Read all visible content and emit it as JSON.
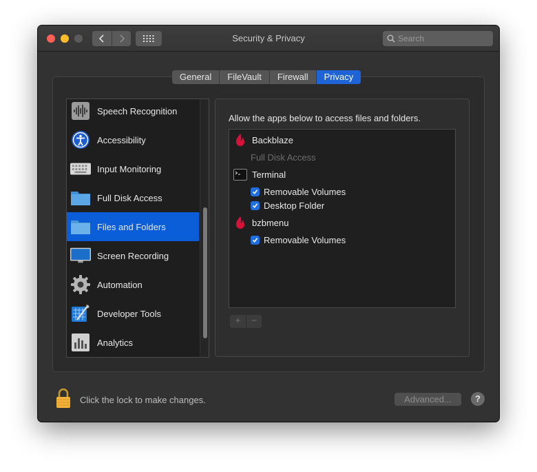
{
  "window": {
    "title": "Security & Privacy"
  },
  "toolbar": {
    "back_icon": "chevron-left-icon",
    "forward_icon": "chevron-right-icon",
    "grid_icon": "grid-icon",
    "search": {
      "placeholder": "Search",
      "value": ""
    }
  },
  "tabs": [
    {
      "label": "General",
      "active": false
    },
    {
      "label": "FileVault",
      "active": false
    },
    {
      "label": "Firewall",
      "active": false
    },
    {
      "label": "Privacy",
      "active": true
    }
  ],
  "sidebar": {
    "items": [
      {
        "label": "Speech Recognition",
        "icon": "waveform-icon",
        "selected": false
      },
      {
        "label": "Accessibility",
        "icon": "accessibility-icon",
        "selected": false
      },
      {
        "label": "Input Monitoring",
        "icon": "keyboard-icon",
        "selected": false
      },
      {
        "label": "Full Disk Access",
        "icon": "folder-icon",
        "selected": false
      },
      {
        "label": "Files and Folders",
        "icon": "folder-icon",
        "selected": true
      },
      {
        "label": "Screen Recording",
        "icon": "monitor-icon",
        "selected": false
      },
      {
        "label": "Automation",
        "icon": "gear-icon",
        "selected": false
      },
      {
        "label": "Developer Tools",
        "icon": "xcode-icon",
        "selected": false
      },
      {
        "label": "Analytics",
        "icon": "bar-chart-icon",
        "selected": false
      }
    ]
  },
  "main": {
    "description": "Allow the apps below to access files and folders.",
    "apps": [
      {
        "name": "Backblaze",
        "icon": "backblaze-flame-icon",
        "permissions": [
          {
            "label": "Full Disk Access",
            "checked": false,
            "disabled": true
          }
        ]
      },
      {
        "name": "Terminal",
        "icon": "terminal-icon",
        "permissions": [
          {
            "label": "Removable Volumes",
            "checked": true,
            "disabled": false
          },
          {
            "label": "Desktop Folder",
            "checked": true,
            "disabled": false
          }
        ]
      },
      {
        "name": "bzbmenu",
        "icon": "backblaze-flame-icon",
        "permissions": [
          {
            "label": "Removable Volumes",
            "checked": true,
            "disabled": false
          }
        ]
      }
    ],
    "add_label": "+",
    "remove_label": "−"
  },
  "footer": {
    "lock_icon": "lock-icon",
    "lock_text": "Click the lock to make changes.",
    "advanced_label": "Advanced...",
    "help_label": "?"
  },
  "colors": {
    "accent": "#0b5ed7",
    "window_bg": "#323232",
    "list_bg": "#1e1e1e",
    "backblaze_red": "#d6123a"
  }
}
